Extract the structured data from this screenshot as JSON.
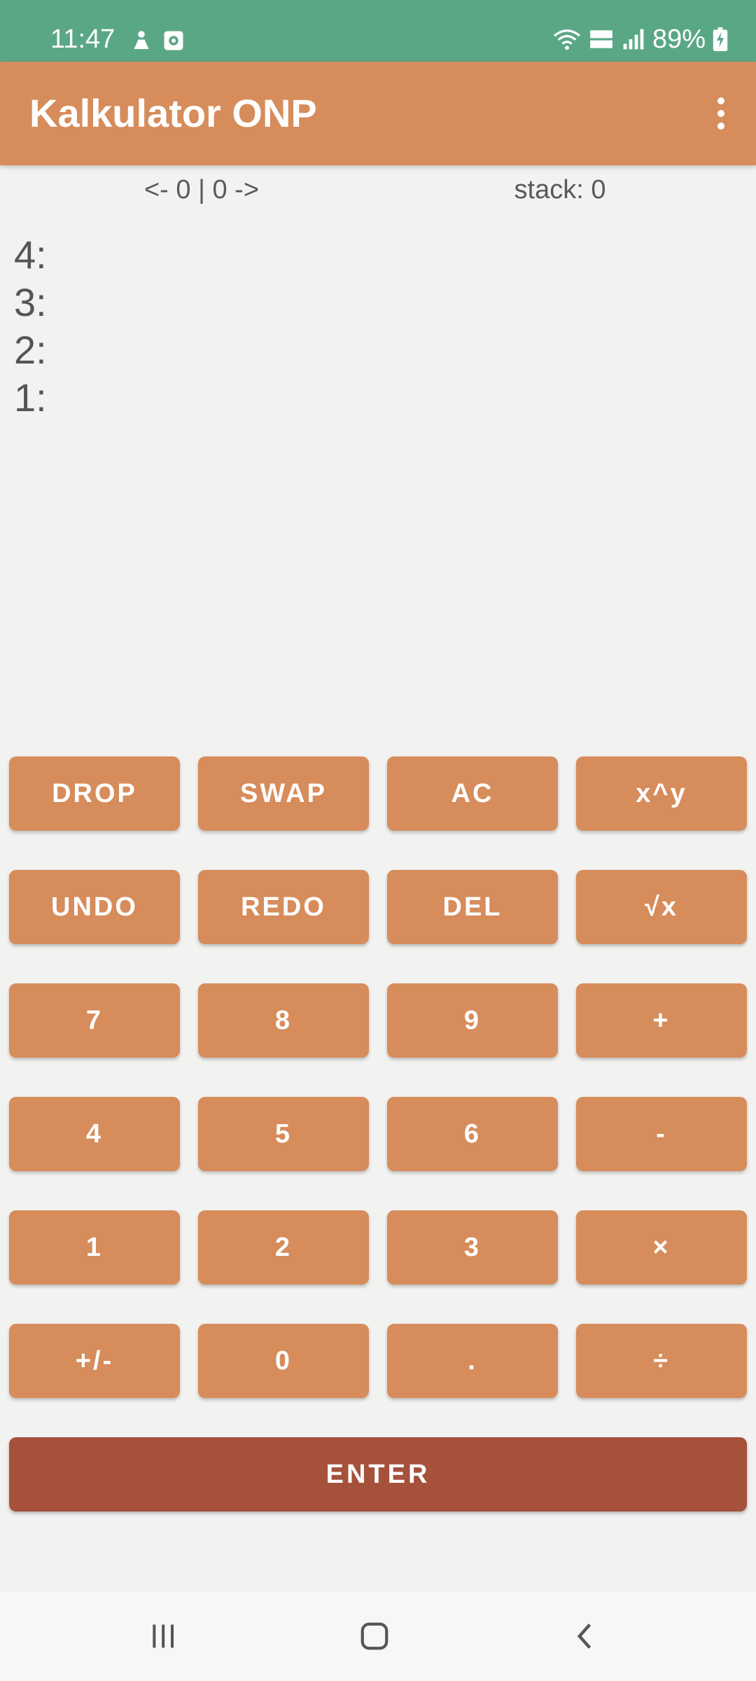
{
  "status": {
    "time": "11:47",
    "battery": "89%"
  },
  "app": {
    "title": "Kalkulator ONP"
  },
  "info": {
    "history": "<- 0 | 0 ->",
    "stack": "stack: 0"
  },
  "stack_lines": [
    "4:",
    "3:",
    "2:",
    "1:"
  ],
  "keys": [
    [
      "DROP",
      "SWAP",
      "AC",
      "x^y"
    ],
    [
      "UNDO",
      "REDO",
      "DEL",
      "√x"
    ],
    [
      "7",
      "8",
      "9",
      "+"
    ],
    [
      "4",
      "5",
      "6",
      "-"
    ],
    [
      "1",
      "2",
      "3",
      "×"
    ],
    [
      "+/-",
      "0",
      ".",
      "÷"
    ]
  ],
  "enter": "ENTER",
  "colors": {
    "status_bar": "#5aa785",
    "app_bar": "#d68d5b",
    "key": "#d78c5b",
    "enter": "#a5513b",
    "background": "#f2f2f0"
  },
  "icons": [
    "person-icon",
    "screen-record-icon",
    "wifi-icon",
    "volte-icon",
    "signal-icon",
    "battery-charging-icon",
    "overflow-menu-icon",
    "recent-apps-icon",
    "home-icon",
    "back-icon"
  ]
}
